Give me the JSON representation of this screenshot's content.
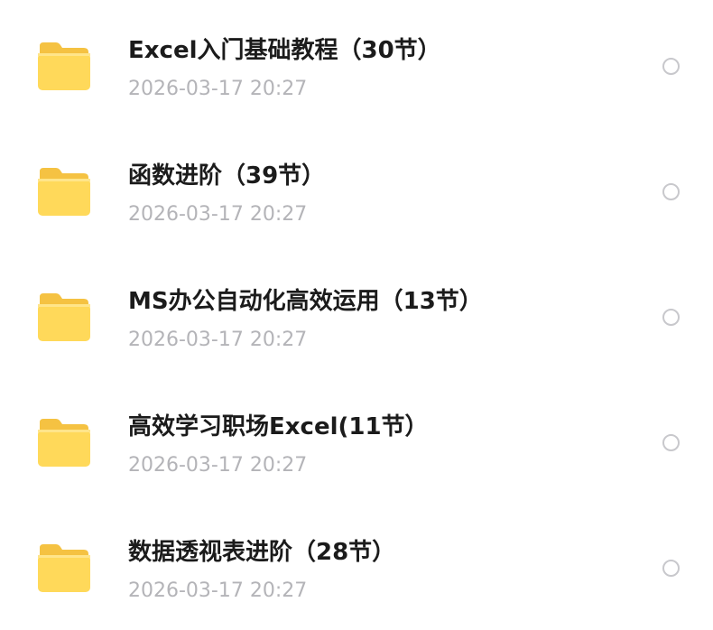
{
  "files": [
    {
      "name": "Excel入门基础教程（30节）",
      "date": "2026-03-17 20:27",
      "icon": "folder-icon"
    },
    {
      "name": "函数进阶（39节）",
      "date": "2026-03-17 20:27",
      "icon": "folder-icon"
    },
    {
      "name": "MS办公自动化高效运用（13节）",
      "date": "2026-03-17 20:27",
      "icon": "folder-icon"
    },
    {
      "name": "高效学习职场Excel(11节）",
      "date": "2026-03-17 20:27",
      "icon": "folder-icon"
    },
    {
      "name": "数据透视表进阶（28节）",
      "date": "2026-03-17 20:27",
      "icon": "folder-icon"
    }
  ],
  "colors": {
    "folder_back": "#F5C242",
    "folder_front": "#FFD95A",
    "title_text": "#1B1B1B",
    "date_text": "#B4B4B8",
    "radio_border": "#C8C8CC"
  }
}
